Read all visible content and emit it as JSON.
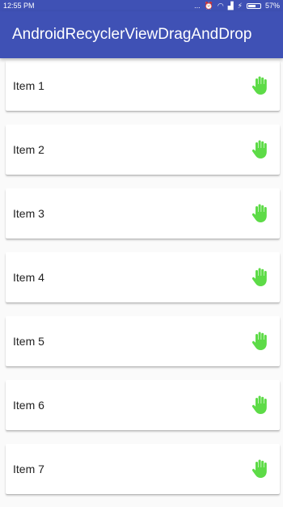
{
  "status_bar": {
    "time": "12:55 PM",
    "dots": "...",
    "battery": "57%"
  },
  "app_bar": {
    "title": "AndroidRecyclerViewDragAndDrop"
  },
  "items": [
    {
      "label": "Item 1"
    },
    {
      "label": "Item 2"
    },
    {
      "label": "Item 3"
    },
    {
      "label": "Item 4"
    },
    {
      "label": "Item 5"
    },
    {
      "label": "Item 6"
    },
    {
      "label": "Item 7"
    }
  ],
  "icons": {
    "drag_handle": "hand-icon",
    "drag_handle_color": "#5ddb47",
    "accent": "#3f51b5"
  }
}
